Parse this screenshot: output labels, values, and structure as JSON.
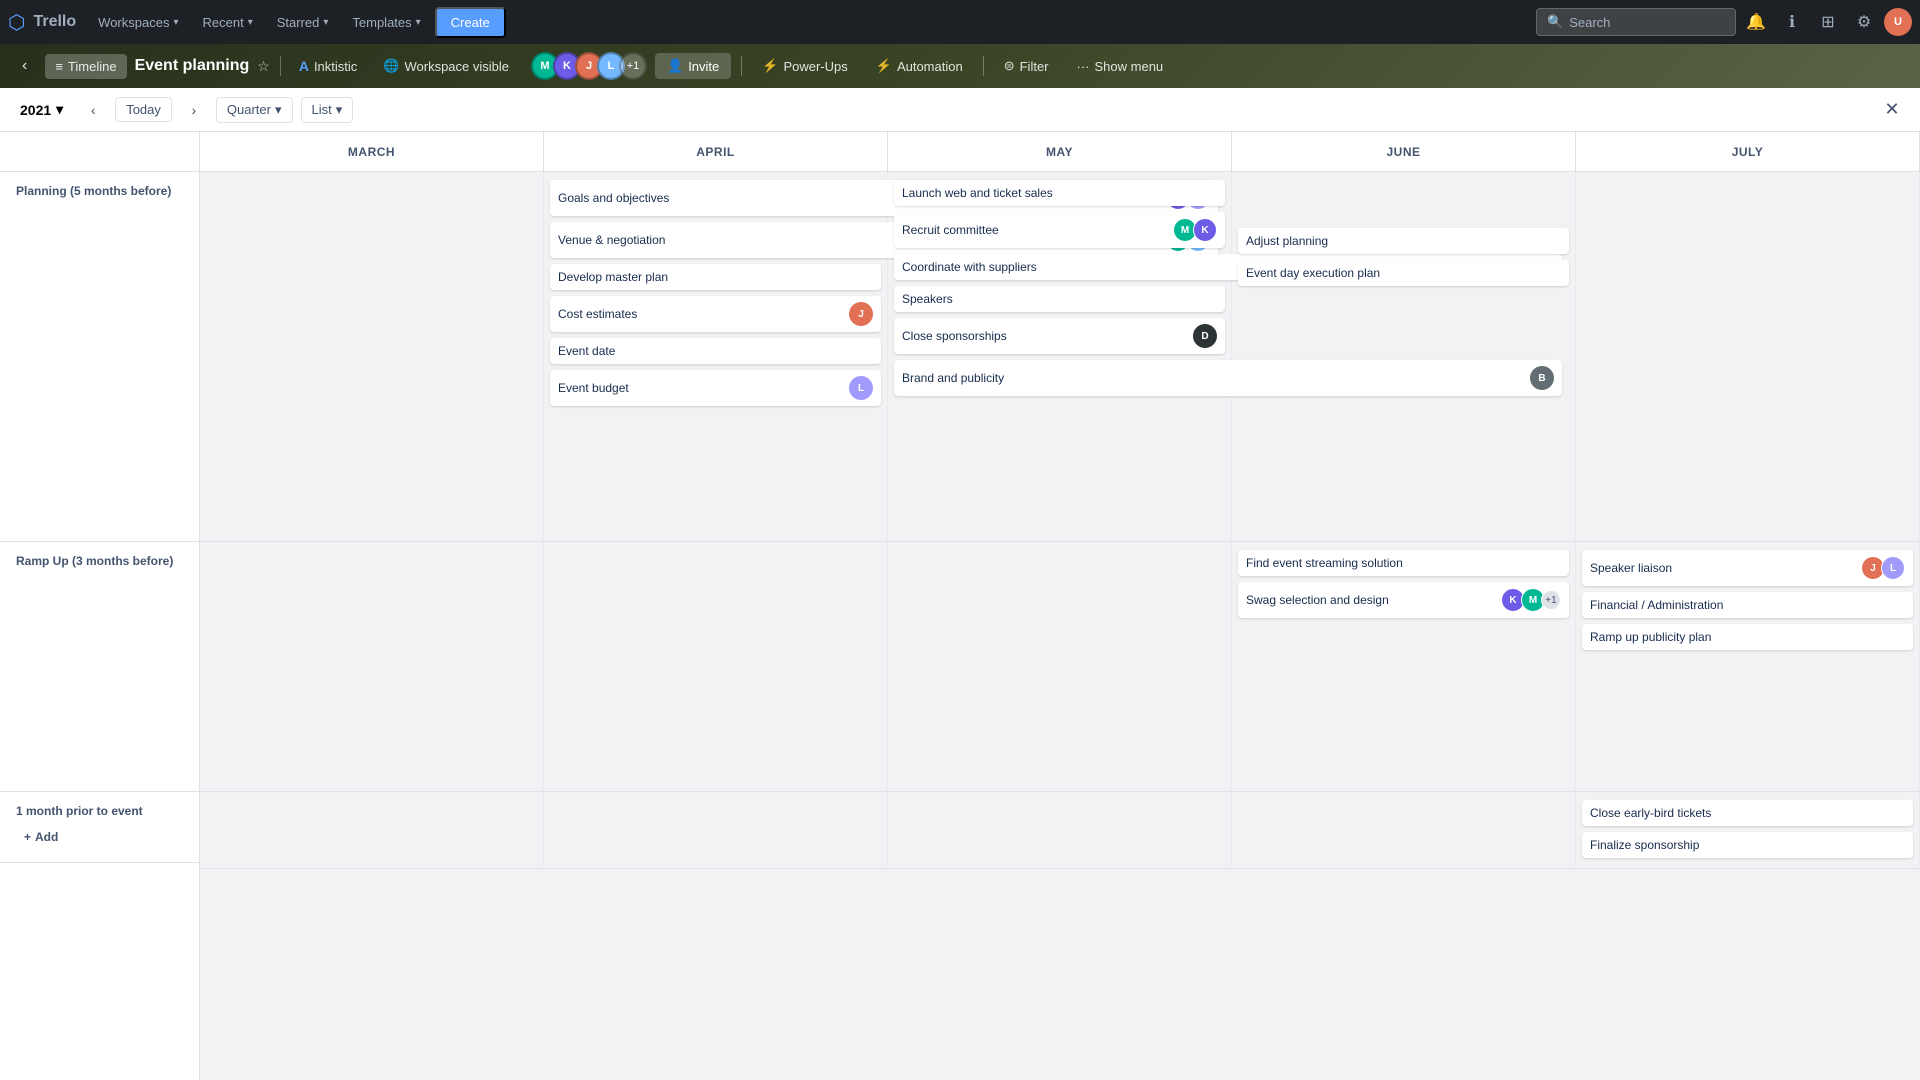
{
  "topNav": {
    "logo": "⊞",
    "trello": "Trello",
    "workspaces": "Workspaces",
    "recent": "Recent",
    "starred": "Starred",
    "templates": "Templates",
    "create": "Create",
    "search": "Search",
    "searchPlaceholder": "Search"
  },
  "boardNav": {
    "timeline": "Timeline",
    "boardTitle": "Event planning",
    "workspace": "Inktistic",
    "workspaceVisible": "Workspace visible",
    "powerUps": "Power-Ups",
    "automation": "Automation",
    "filter": "Filter",
    "showMenu": "Show menu",
    "invite": "Invite"
  },
  "timelineControls": {
    "year": "2021",
    "today": "Today",
    "viewMode": "Quarter",
    "viewMode2": "List"
  },
  "months": [
    "MARCH",
    "APRIL",
    "MAY",
    "JUNE",
    "JULY"
  ],
  "rows": [
    {
      "label": "Planning (5 months before)",
      "rowType": "planning"
    },
    {
      "label": "Ramp Up (3 months before)",
      "rowType": "ramp"
    },
    {
      "label": "1 month prior to event",
      "rowType": "month",
      "addLabel": "Add"
    }
  ],
  "cards": {
    "planning": {
      "march": [],
      "april": [
        {
          "id": "goals",
          "text": "Goals and objectives",
          "avatars": [
            "#6c5ce7",
            "#a29bfe"
          ],
          "col": "april",
          "span": 1
        },
        {
          "id": "venue",
          "text": "Venue & negotiation",
          "avatars": [
            "#00b894",
            "#74b9ff"
          ],
          "col": "april",
          "span": 1
        },
        {
          "id": "develop",
          "text": "Develop master plan",
          "col": "april",
          "span": 1
        },
        {
          "id": "cost",
          "text": "Cost estimates",
          "avatars": [
            "#e17055"
          ],
          "col": "april",
          "span": 1
        },
        {
          "id": "eventdate",
          "text": "Event date",
          "col": "april",
          "span": 1
        },
        {
          "id": "budget",
          "text": "Event budget",
          "avatars": [
            "#a29bfe"
          ],
          "col": "april",
          "span": 1
        }
      ],
      "may": [
        {
          "id": "launch",
          "text": "Launch web and ticket sales",
          "col": "may",
          "span": 1
        },
        {
          "id": "recruit",
          "text": "Recruit committee",
          "avatars": [
            "#00b894",
            "#6c5ce7"
          ],
          "col": "may",
          "span": 1
        },
        {
          "id": "coordinate",
          "text": "Coordinate with suppliers",
          "col": "may-june",
          "span": 2
        },
        {
          "id": "speakers",
          "text": "Speakers",
          "col": "may",
          "span": 1
        },
        {
          "id": "close-spons",
          "text": "Close sponsorships",
          "avatars": [
            "#2d3436"
          ],
          "col": "may",
          "span": 1
        },
        {
          "id": "brand",
          "text": "Brand and publicity",
          "avatars": [
            "#636e72"
          ],
          "col": "may",
          "span": 2
        }
      ],
      "june": [
        {
          "id": "adjust",
          "text": "Adjust planning",
          "col": "june",
          "span": 1
        },
        {
          "id": "eventday",
          "text": "Event day execution plan",
          "col": "june",
          "span": 1
        }
      ],
      "july": []
    },
    "ramp": {
      "march": [],
      "april": [],
      "may": [],
      "june": [
        {
          "id": "streaming",
          "text": "Find event streaming solution",
          "col": "june",
          "span": 1
        },
        {
          "id": "swag",
          "text": "Swag selection and design",
          "avatars": [
            "#6c5ce7",
            "#00b894"
          ],
          "count": "+1",
          "col": "june",
          "span": 1
        }
      ],
      "july": [
        {
          "id": "speaker-liaison",
          "text": "Speaker liaison",
          "avatars": [
            "#e17055",
            "#a29bfe"
          ],
          "col": "july",
          "span": 1
        },
        {
          "id": "financial",
          "text": "Financial / Administration",
          "col": "july",
          "span": 1
        },
        {
          "id": "ramp-publicity",
          "text": "Ramp up publicity plan",
          "col": "july",
          "span": 1
        }
      ]
    },
    "monthPrior": {
      "march": [],
      "april": [],
      "may": [],
      "june": [],
      "july": [
        {
          "id": "early-bird",
          "text": "Close early-bird tickets",
          "col": "july",
          "span": 1
        },
        {
          "id": "finalize",
          "text": "Finalize sponsorship",
          "col": "july",
          "span": 1
        }
      ]
    }
  },
  "avatarColors": {
    "a1": "#6c5ce7",
    "a2": "#00b894",
    "a3": "#e17055",
    "a4": "#74b9ff",
    "a5": "#a29bfe",
    "a6": "#2d3436",
    "a7": "#636e72"
  }
}
